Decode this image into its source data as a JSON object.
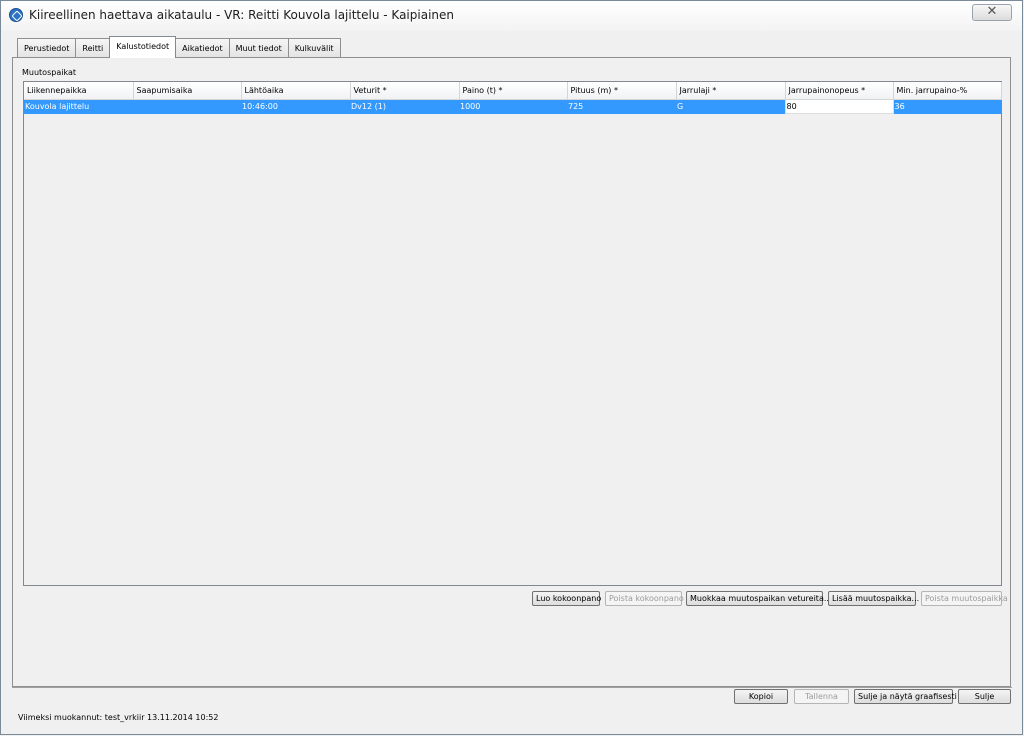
{
  "window": {
    "title": "Kiireellinen haettava aikataulu - VR: Reitti Kouvola lajittelu - Kaipiainen",
    "close_symbol": "✕"
  },
  "tabs": [
    {
      "label": "Perustiedot",
      "active": false
    },
    {
      "label": "Reitti",
      "active": false
    },
    {
      "label": "Kalustotiedot",
      "active": true
    },
    {
      "label": "Aikatiedot",
      "active": false
    },
    {
      "label": "Muut tiedot",
      "active": false
    },
    {
      "label": "Kulkuvälit",
      "active": false
    }
  ],
  "section": {
    "label": "Muutospaikat"
  },
  "table": {
    "columns": [
      "Liikennepaikka",
      "Saapumisaika",
      "Lähtöaika",
      "Veturit *",
      "Paino (t) *",
      "Pituus (m) *",
      "Jarrulaji *",
      "Jarrupainonopeus *",
      "Min. jarrupaino-%"
    ],
    "rows": [
      [
        "Kouvola lajittelu",
        "",
        "10:46:00",
        "Dv12 (1)",
        "1000",
        "725",
        "G",
        "80",
        "36"
      ]
    ]
  },
  "table_buttons": {
    "create": "Luo kokoonpano",
    "remove_composition": "Poista kokoonpano",
    "edit_locos": "Muokkaa muutospaikan vetureita...",
    "add_change_point": "Lisää muutospaikka...",
    "remove_change_point": "Poista muutospaikka"
  },
  "footer_buttons": {
    "copy": "Kopioi",
    "save": "Tallenna",
    "close_graphical": "Sulje ja näytä graafisesti",
    "close": "Sulje"
  },
  "status": {
    "text": "Viimeksi muokannut: test_vrkiir 13.11.2014 10:52"
  }
}
